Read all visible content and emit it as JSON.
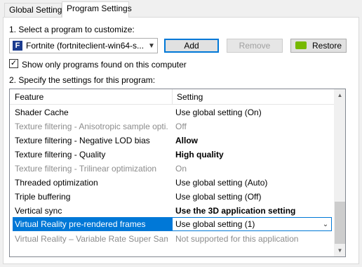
{
  "tabs": [
    {
      "label": "Global Settings",
      "active": false
    },
    {
      "label": "Program Settings",
      "active": true
    }
  ],
  "step1": {
    "label": "1. Select a program to customize:"
  },
  "program_select": {
    "value": "Fortnite (fortniteclient-win64-s...",
    "icon": "fortnite-app-icon"
  },
  "buttons": {
    "add": "Add",
    "remove": "Remove",
    "restore": "Restore"
  },
  "show_only": {
    "label": "Show only programs found on this computer",
    "checked": true
  },
  "step2": {
    "label": "2. Specify the settings for this program:"
  },
  "table": {
    "headers": {
      "feature": "Feature",
      "setting": "Setting"
    },
    "rows": [
      {
        "feature": "Shader Cache",
        "setting": "Use global setting (On)",
        "dim": false,
        "bold": false,
        "selected": false
      },
      {
        "feature": "Texture filtering - Anisotropic sample opti...",
        "setting": "Off",
        "dim": true,
        "bold": false,
        "selected": false
      },
      {
        "feature": "Texture filtering - Negative LOD bias",
        "setting": "Allow",
        "dim": false,
        "bold": true,
        "selected": false
      },
      {
        "feature": "Texture filtering - Quality",
        "setting": "High quality",
        "dim": false,
        "bold": true,
        "selected": false
      },
      {
        "feature": "Texture filtering - Trilinear optimization",
        "setting": "On",
        "dim": true,
        "bold": false,
        "selected": false
      },
      {
        "feature": "Threaded optimization",
        "setting": "Use global setting (Auto)",
        "dim": false,
        "bold": false,
        "selected": false
      },
      {
        "feature": "Triple buffering",
        "setting": "Use global setting (Off)",
        "dim": false,
        "bold": false,
        "selected": false
      },
      {
        "feature": "Vertical sync",
        "setting": "Use the 3D application setting",
        "dim": false,
        "bold": true,
        "selected": false
      },
      {
        "feature": "Virtual Reality pre-rendered frames",
        "setting": "Use global setting (1)",
        "dim": false,
        "bold": false,
        "selected": true
      },
      {
        "feature": "Virtual Reality – Variable Rate Super Samp...",
        "setting": "Not supported for this application",
        "dim": true,
        "bold": false,
        "selected": false
      }
    ]
  },
  "colors": {
    "selection": "#0078d7",
    "nvidia_green": "#76b900",
    "disabled_text": "#8c8c8c"
  }
}
